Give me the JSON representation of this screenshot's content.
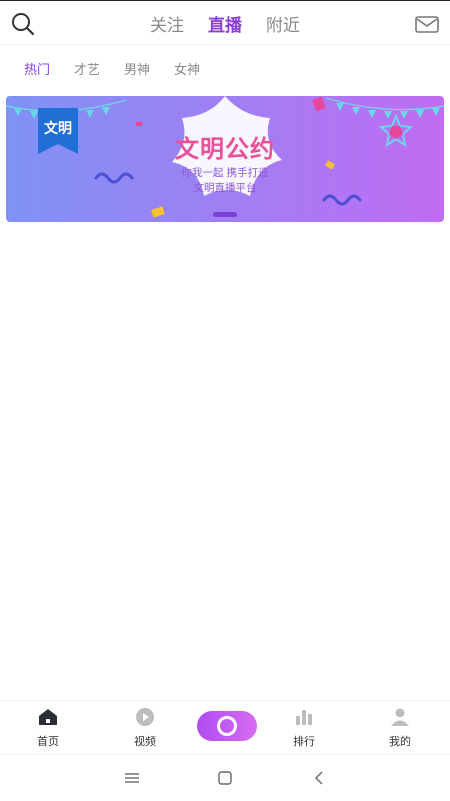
{
  "header": {
    "tabs": [
      {
        "label": "关注",
        "active": false
      },
      {
        "label": "直播",
        "active": true
      },
      {
        "label": "附近",
        "active": false
      }
    ],
    "left_icon": "search-icon",
    "right_icon": "mail-icon"
  },
  "subtabs": [
    {
      "label": "热门",
      "active": true
    },
    {
      "label": "才艺",
      "active": false
    },
    {
      "label": "男神",
      "active": false
    },
    {
      "label": "女神",
      "active": false
    }
  ],
  "banner": {
    "badge": "文明",
    "title": "文明公约",
    "line1": "你我一起  携手打造",
    "line2": "文明直播平台"
  },
  "bottom_nav": {
    "items": [
      {
        "label": "首页",
        "icon": "home-icon"
      },
      {
        "label": "视频",
        "icon": "video-icon"
      },
      {
        "label": "",
        "icon": "live-icon"
      },
      {
        "label": "排行",
        "icon": "ranking-icon"
      },
      {
        "label": "我的",
        "icon": "profile-icon"
      }
    ]
  },
  "colors": {
    "accent": "#8b3fd9",
    "banner_left": "#7f92f5",
    "banner_right": "#c06cf3"
  }
}
